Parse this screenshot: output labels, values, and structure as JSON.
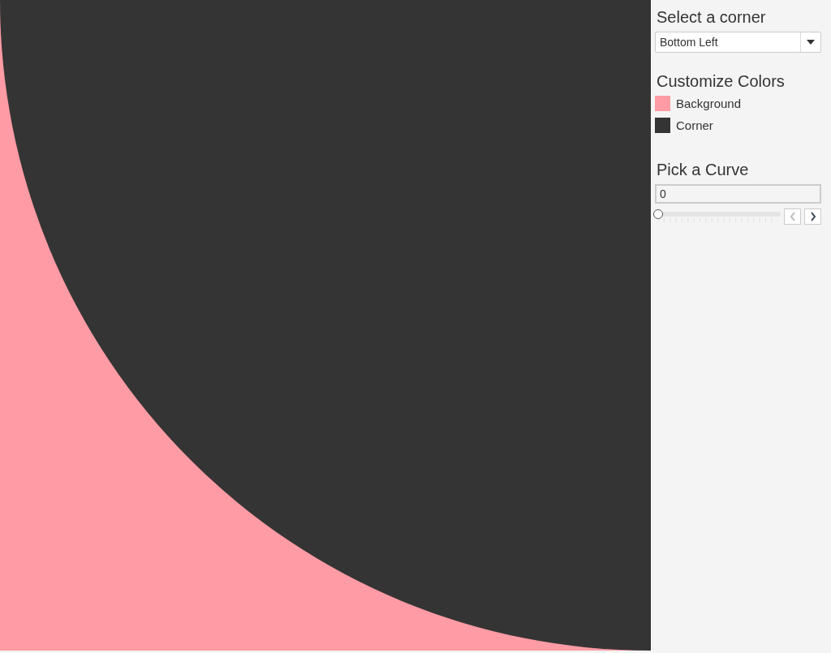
{
  "corner_select": {
    "label": "Select a corner",
    "value": "Bottom Left"
  },
  "colors": {
    "title": "Customize Colors",
    "items": [
      {
        "label": "Background",
        "color": "#ff9ba4"
      },
      {
        "label": "Corner",
        "color": "#343434"
      }
    ]
  },
  "curve": {
    "title": "Pick a Curve",
    "value": "0",
    "level": 0,
    "prev_disabled": true,
    "next_disabled": false
  }
}
